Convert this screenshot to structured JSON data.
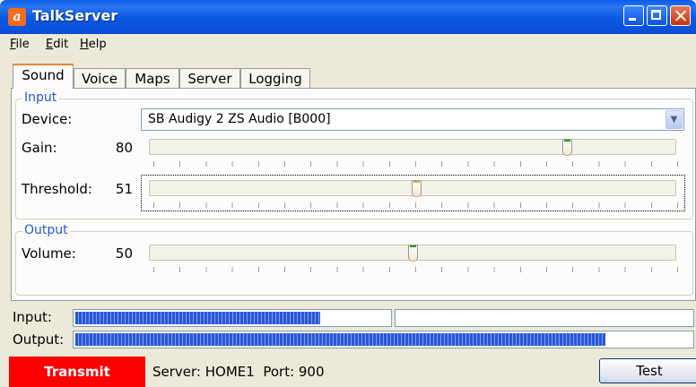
{
  "window": {
    "title": "TalkServer"
  },
  "menu": [
    "File",
    "Edit",
    "Help"
  ],
  "tabs": [
    "Sound",
    "Voice",
    "Maps",
    "Server",
    "Logging"
  ],
  "input_group": {
    "title": "Input",
    "device_label": "Device:",
    "device_value": "SB Audigy 2 ZS Audio [B000]",
    "gain_label": "Gain:",
    "gain_value": "80",
    "threshold_label": "Threshold:",
    "threshold_value": "51"
  },
  "output_group": {
    "title": "Output",
    "volume_label": "Volume:",
    "volume_value": "50"
  },
  "meters": {
    "input_label": "Input:",
    "input_level": 0.78,
    "output_label": "Output:",
    "output_level": 0.86
  },
  "status": {
    "transmit_label": "Transmit",
    "text": "Server: HOME1  Port: 900",
    "test_label": "Test"
  },
  "colors": {
    "titlebar": "#0a58e2",
    "transmit": "#ff0000",
    "group_title": "#2a56c8"
  },
  "icons": [
    "app-icon",
    "minimize-icon",
    "maximize-icon",
    "close-icon",
    "chevron-down-icon"
  ]
}
